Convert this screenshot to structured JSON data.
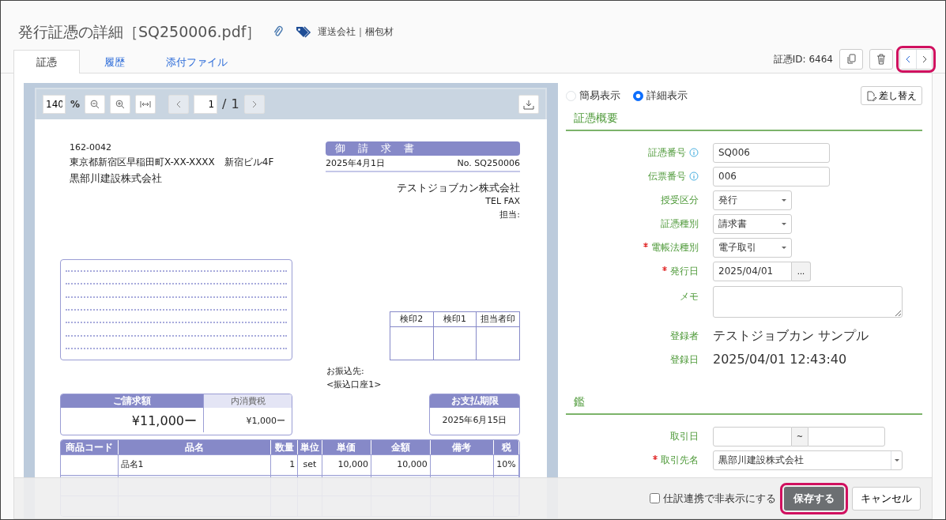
{
  "header": {
    "title": "発行証憑の詳細［SQ250006.pdf］",
    "tags": "運送会社｜梱包材"
  },
  "tabs": [
    {
      "label": "証憑",
      "selected": true
    },
    {
      "label": "履歴",
      "selected": false
    },
    {
      "label": "添付ファイル",
      "selected": false
    }
  ],
  "record": {
    "id_label": "証憑ID: 6464",
    "nav_highlighted": true
  },
  "viewer": {
    "zoom": "140",
    "percent": "%",
    "page": "1",
    "separator": "/",
    "total": "1"
  },
  "document": {
    "postal": "162-0042",
    "address": "東京都新宿区早稲田町X-XX-XXXX　新宿ビル4F",
    "recipient": "黒部川建設株式会社",
    "title": "御 請 求 書",
    "date": "2025年4月1日",
    "number": "No. SQ250006",
    "issuer": "テストジョブカン株式会社",
    "contact": "TEL FAX",
    "person": "担当:",
    "stamps": [
      "検印2",
      "検印1",
      "担当者印"
    ],
    "bank_label": "お振込先:",
    "bank": "<振込口座1>",
    "amount_label": "ご請求額",
    "amount": "¥11,000ー",
    "tax_label": "内消費税",
    "tax": "¥1,000ー",
    "due_label": "お支払期限",
    "due": "2025年6月15日",
    "columns": [
      "商品コード",
      "品名",
      "数量",
      "単位",
      "単価",
      "金額",
      "備考",
      "税"
    ],
    "rows": [
      {
        "name": "品名1",
        "qty": "1",
        "unit": "set",
        "price": "10,000",
        "amount": "10,000",
        "tax": "10%"
      }
    ]
  },
  "view_modes": [
    {
      "label": "簡易表示",
      "selected": false
    },
    {
      "label": "詳細表示",
      "selected": true
    }
  ],
  "replace_button": "差し替え",
  "sections": [
    {
      "title": "証憑概要",
      "fields": [
        {
          "kind": "text",
          "label": "証憑番号",
          "required": false,
          "info": true,
          "value": "SQ006"
        },
        {
          "kind": "text",
          "label": "伝票番号",
          "required": false,
          "info": true,
          "value": "006"
        },
        {
          "kind": "select",
          "label": "授受区分",
          "required": false,
          "info": false,
          "value": "発行"
        },
        {
          "kind": "select",
          "label": "証憑種別",
          "required": false,
          "info": false,
          "value": "請求書"
        },
        {
          "kind": "select",
          "label": "電帳法種別",
          "required": true,
          "info": false,
          "value": "電子取引"
        },
        {
          "kind": "date",
          "label": "発行日",
          "required": true,
          "info": false,
          "value": "2025/04/01",
          "button": "..."
        },
        {
          "kind": "textarea",
          "label": "メモ",
          "required": false,
          "info": false
        },
        {
          "kind": "static",
          "label": "登録者",
          "required": false,
          "info": false,
          "value": "テストジョブカン サンプル"
        },
        {
          "kind": "static",
          "label": "登録日",
          "required": false,
          "info": false,
          "value": "2025/04/01 12:43:40"
        }
      ]
    },
    {
      "title": "鑑",
      "fields": [
        {
          "kind": "range",
          "label": "取引日",
          "required": false,
          "info": false,
          "separator": "~"
        },
        {
          "kind": "combo",
          "label": "取引先名",
          "required": true,
          "info": false,
          "value": "黒部川建設株式会社"
        }
      ]
    }
  ],
  "footer": {
    "checkbox": {
      "label": "仕訳連携で非表示にする",
      "checked": false
    },
    "save": "保存する",
    "save_highlighted": true,
    "cancel": "キャンセル"
  }
}
